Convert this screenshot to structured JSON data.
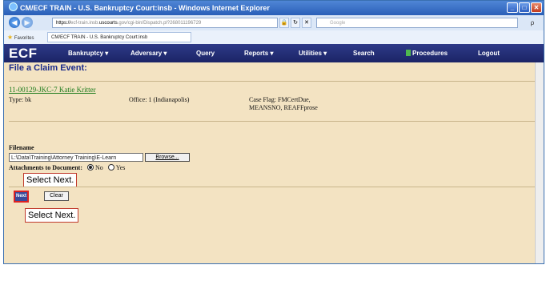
{
  "window": {
    "title": "CM/ECF TRAIN - U.S. Bankruptcy Court:insb - Windows Internet Explorer",
    "controls": [
      "_",
      "□",
      "✕"
    ]
  },
  "address_bar": {
    "prefix": "https://",
    "url_faint": "ecf-train.insb.",
    "url_strong": "uscourts",
    "url_tail": ".gov/cgi-bin/Dispatch.pl?268011196729",
    "search_placeholder": "Google",
    "search_glyph": "ρ"
  },
  "favorites": {
    "favorites_label": "Favorites",
    "tab_label": "CM/ECF TRAIN - U.S. Bankruptcy Court:insb"
  },
  "ecf_menu": {
    "logo": "ECF",
    "items": [
      "Bankruptcy ▾",
      "Adversary ▾",
      "Query",
      "Reports ▾",
      "Utilities ▾",
      "Search",
      "Procedures",
      "Logout"
    ]
  },
  "page": {
    "title": "File a Claim Event:",
    "case_link": "11-00129-JKC-7 Katie Kritter",
    "type": "Type: bk",
    "office": "Office: 1 (Indianapolis)",
    "case_flag_line1": "Case Flag: FMCertDue,",
    "case_flag_line2": "MEANSNO, REAFFprose",
    "filename_label": "Filename",
    "filename_value": "L:\\Data\\Training\\Attorney Training\\E-Learn",
    "browse_label": "Browse...",
    "attachments_label": "Attachments to Document:",
    "no_label": "No",
    "yes_label": "Yes",
    "attachments_selected": "No",
    "next_label": "Next",
    "clear_label": "Clear"
  },
  "callouts": {
    "top": "Select Next.",
    "bottom": "Select Next."
  }
}
